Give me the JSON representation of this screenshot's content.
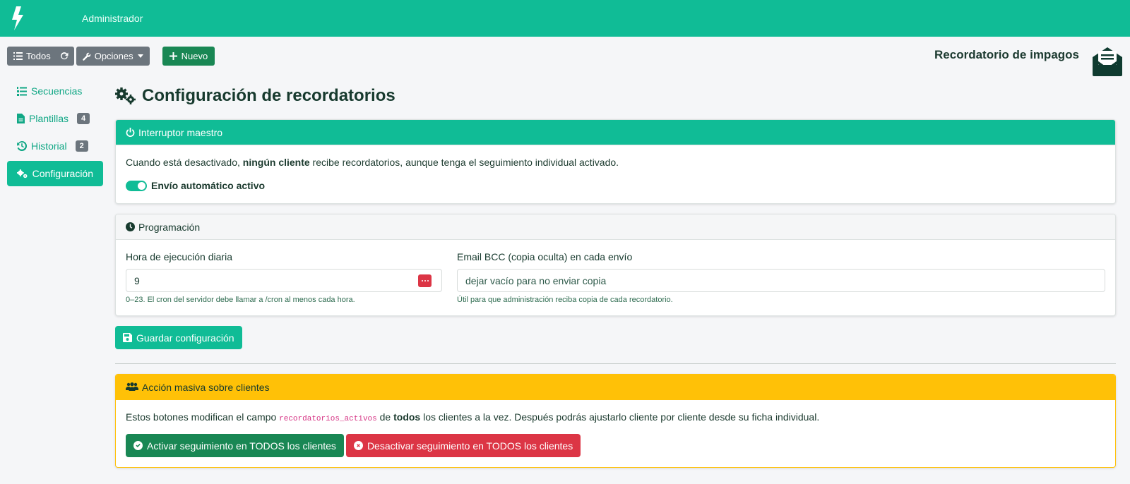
{
  "navbar": {
    "user": "Administrador",
    "bg_color": "#10bc96"
  },
  "toolbar": {
    "all_label": "Todos",
    "options_label": "Opciones",
    "new_label": "Nuevo"
  },
  "module": {
    "title": "Recordatorio de impagos"
  },
  "sidebar": {
    "items": [
      {
        "label": "Secuencias",
        "icon": "list-ol-icon",
        "badge": null
      },
      {
        "label": "Plantillas",
        "icon": "file-icon",
        "badge": "4"
      },
      {
        "label": "Historial",
        "icon": "history-icon",
        "badge": "2"
      },
      {
        "label": "Configuración",
        "icon": "gears-icon",
        "badge": null,
        "active": true
      }
    ]
  },
  "page": {
    "title": "Configuración de recordatorios"
  },
  "master_switch": {
    "header": "Interruptor maestro",
    "text_before": "Cuando está desactivado, ",
    "text_bold": "ningún cliente",
    "text_after": " recibe recordatorios, aunque tenga el seguimiento individual activado.",
    "toggle_label": "Envío automático activo",
    "toggle_on": true
  },
  "schedule": {
    "header": "Programación",
    "hour_label": "Hora de ejecución diaria",
    "hour_value": "9",
    "hour_help": "0–23. El cron del servidor debe llamar a /cron al menos cada hora.",
    "bcc_label": "Email BCC (copia oculta) en cada envío",
    "bcc_placeholder": "dejar vacío para no enviar copia",
    "bcc_help": "Útil para que administración reciba copia de cada recordatorio."
  },
  "save_button": "Guardar configuración",
  "bulk": {
    "header": "Acción masiva sobre clientes",
    "text_before": "Estos botones modifican el campo ",
    "text_code": "recordatorios_activos",
    "text_mid": " de ",
    "text_bold": "todos",
    "text_after": " los clientes a la vez. Después podrás ajustarlo cliente por cliente desde su ficha individual.",
    "activate_label": "Activar seguimiento en TODOS los clientes",
    "deactivate_label": "Desactivar seguimiento en TODOS los clientes"
  },
  "colors": {
    "accent": "#10bc96",
    "success": "#198754",
    "danger": "#dc3545",
    "warning": "#ffc107",
    "secondary": "#6c757d"
  }
}
